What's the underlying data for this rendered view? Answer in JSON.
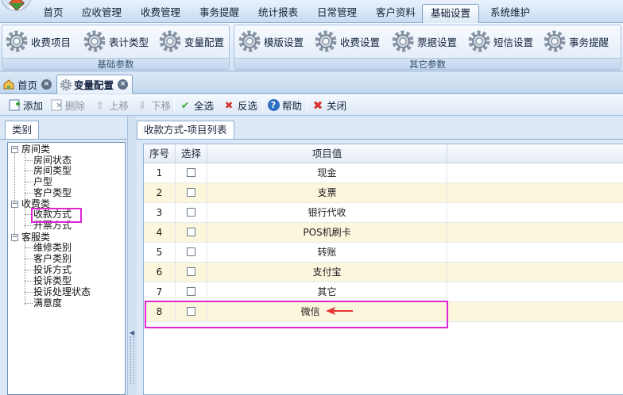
{
  "menu": {
    "items": [
      "首页",
      "应收管理",
      "收费管理",
      "事务提醒",
      "统计报表",
      "日常管理",
      "客户资料",
      "基础设置",
      "系统维护"
    ],
    "active_index": 7
  },
  "ribbon": {
    "group_basic": {
      "label": "基础参数",
      "buttons": [
        "收费项目",
        "表计类型",
        "变量配置"
      ]
    },
    "group_other": {
      "label": "其它参数",
      "buttons": [
        "模版设置",
        "收费设置",
        "票据设置",
        "短信设置",
        "事务提醒"
      ]
    }
  },
  "doc_tabs": [
    {
      "label": "首页",
      "icon": "home-icon"
    },
    {
      "label": "变量配置",
      "icon": "gear-icon"
    }
  ],
  "toolbar": {
    "add": "添加",
    "delete": "删除",
    "up": "上移",
    "down": "下移",
    "select_all": "全选",
    "invert": "反选",
    "help": "帮助",
    "close": "关闭"
  },
  "left": {
    "tab_label": "类别",
    "tree": [
      {
        "label": "房间类",
        "children": [
          "房间状态",
          "房间类型",
          "户型",
          "客户类型"
        ]
      },
      {
        "label": "收费类",
        "children": [
          "收款方式",
          "开票方式"
        ]
      },
      {
        "label": "客服类",
        "children": [
          "维修类别",
          "客户类别",
          "投诉方式",
          "投诉类型",
          "投诉处理状态",
          "满意度"
        ]
      }
    ],
    "selected": "收款方式"
  },
  "right": {
    "tab_label": "收款方式-项目列表",
    "columns": [
      "序号",
      "选择",
      "项目值"
    ],
    "rows": [
      {
        "no": "1",
        "value": "现金"
      },
      {
        "no": "2",
        "value": "支票"
      },
      {
        "no": "3",
        "value": "银行代收"
      },
      {
        "no": "4",
        "value": "POS机刷卡"
      },
      {
        "no": "5",
        "value": "转账"
      },
      {
        "no": "6",
        "value": "支付宝"
      },
      {
        "no": "7",
        "value": "其它"
      },
      {
        "no": "8",
        "value": "微信"
      }
    ]
  },
  "colors": {
    "highlight": "#de26d6",
    "arrow": "#e53333",
    "row_alt": "#fbf6dc"
  }
}
